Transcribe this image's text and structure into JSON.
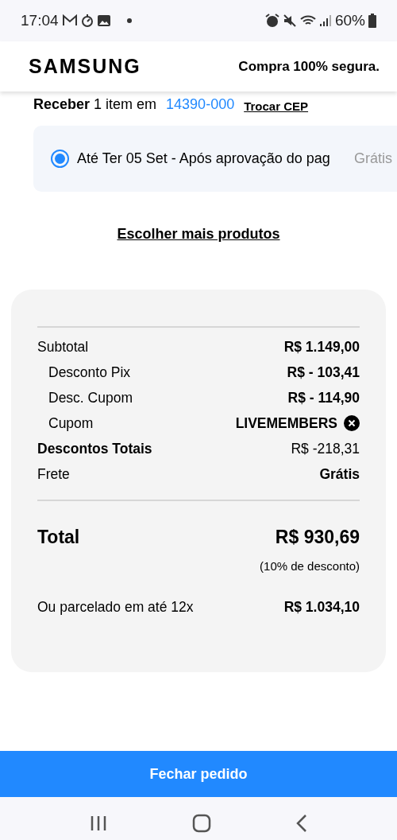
{
  "status_bar": {
    "time": "17:04",
    "battery": "60%"
  },
  "header": {
    "logo": "SAMSUNG",
    "tagline": "Compra 100% segura."
  },
  "delivery": {
    "label": "**Receber** 1 item em",
    "zip": "14390-000",
    "change_link": "Trocar CEP"
  },
  "shipping_options": [
    {
      "label": "Até Ter 05 Set - Após aprovação do pag",
      "price": "Grátis",
      "selected": true
    }
  ],
  "more_products_link": "Escolher mais produtos",
  "summary": {
    "rows": [
      {
        "kind": "amount",
        "label": "Subtotal",
        "value": "R$ 1.149,00",
        "indented": false,
        "bold": false
      },
      {
        "kind": "amount",
        "label": "Desconto Pix",
        "value": "R$ - 103,41",
        "indented": true,
        "bold": false
      },
      {
        "kind": "amount",
        "label": "Desc. Cupom",
        "value": "R$ - 114,90",
        "indented": true,
        "bold": false
      },
      {
        "kind": "coupon",
        "label": "Cupom",
        "value": "LIVEMEMBERS",
        "indented": true,
        "bold": false
      },
      {
        "kind": "amount",
        "label": "Descontos Totais",
        "value": "R$ -218,31",
        "indented": false,
        "bold": true
      },
      {
        "kind": "amount",
        "label": "Frete",
        "value": "Grátis",
        "indented": false,
        "bold": false
      }
    ],
    "total_label": "Total",
    "total_value": "R$ 930,69",
    "discount_note": "(10% de desconto)",
    "installment_label": "Ou parcelado em até 12x",
    "installment_value": "R$ 1.034,10"
  },
  "checkout_button": "Fechar pedido"
}
